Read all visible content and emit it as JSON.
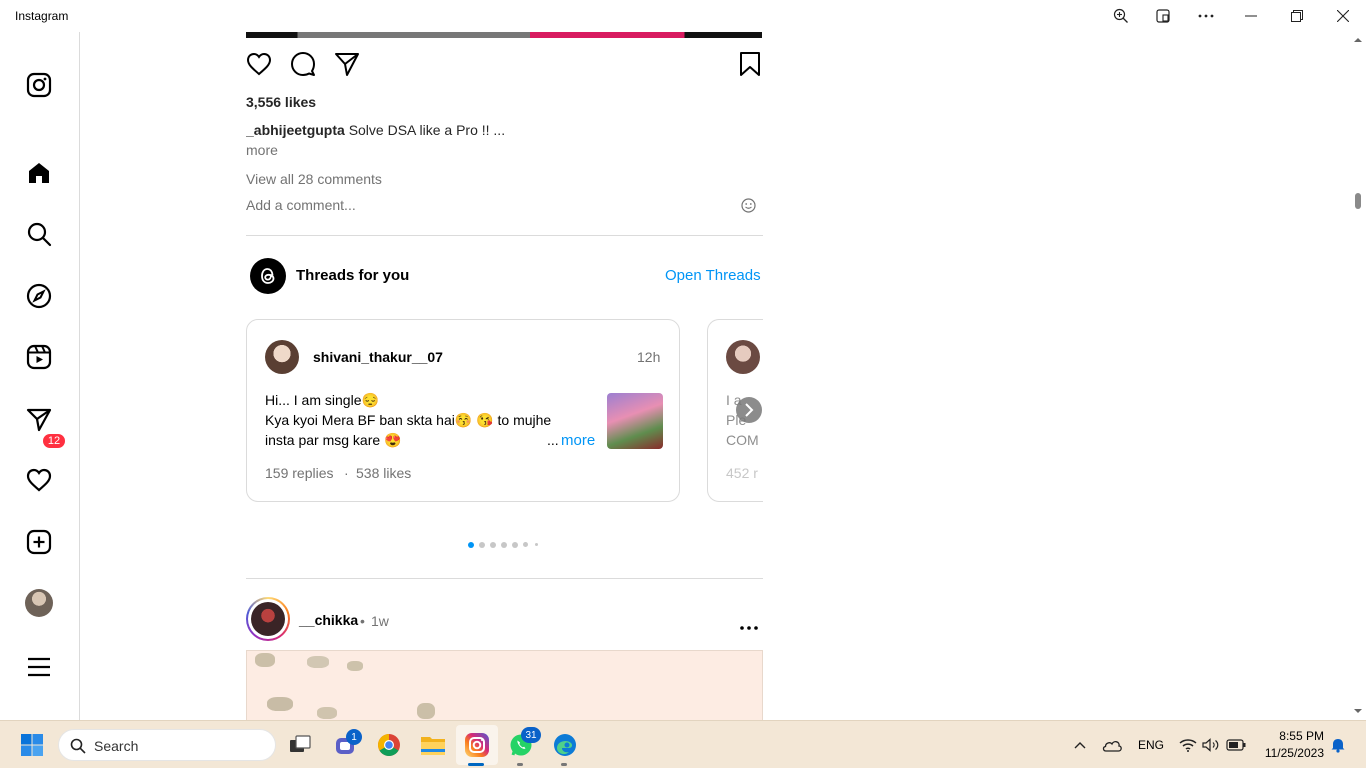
{
  "window": {
    "title": "Instagram"
  },
  "sidebar": {
    "messages_badge": "12"
  },
  "post": {
    "likes": "3,556 likes",
    "username": "_abhijeetgupta",
    "caption": "Solve DSA like a Pro !! ...",
    "more": "more",
    "view_comments": "View all 28 comments",
    "add_comment_placeholder": "Add a comment..."
  },
  "threads": {
    "title": "Threads for you",
    "open_label": "Open Threads",
    "card1": {
      "username": "shivani_thakur__07",
      "time": "12h",
      "line1": "Hi... I am single😔",
      "line2": "Kya kyoi Mera BF ban skta hai😚 😘  to mujhe",
      "line3": "insta par msg kare 😍",
      "ellipsis": "...",
      "more": "more",
      "replies": "159 replies",
      "sep": "·",
      "likes": "538 likes"
    },
    "card2": {
      "line1": "I a",
      "line2": "Ple",
      "line3": "COM",
      "stats": "452 r"
    }
  },
  "next_post": {
    "username": "__chikka",
    "sep": "•",
    "time": "1w"
  },
  "taskbar": {
    "search_placeholder": "Search",
    "teams_badge": "1",
    "whatsapp_badge": "31",
    "language": "ENG",
    "time": "8:55 PM",
    "date": "11/25/2023"
  },
  "colors": {
    "accent": "#0095f6",
    "badge": "#ff3040"
  }
}
